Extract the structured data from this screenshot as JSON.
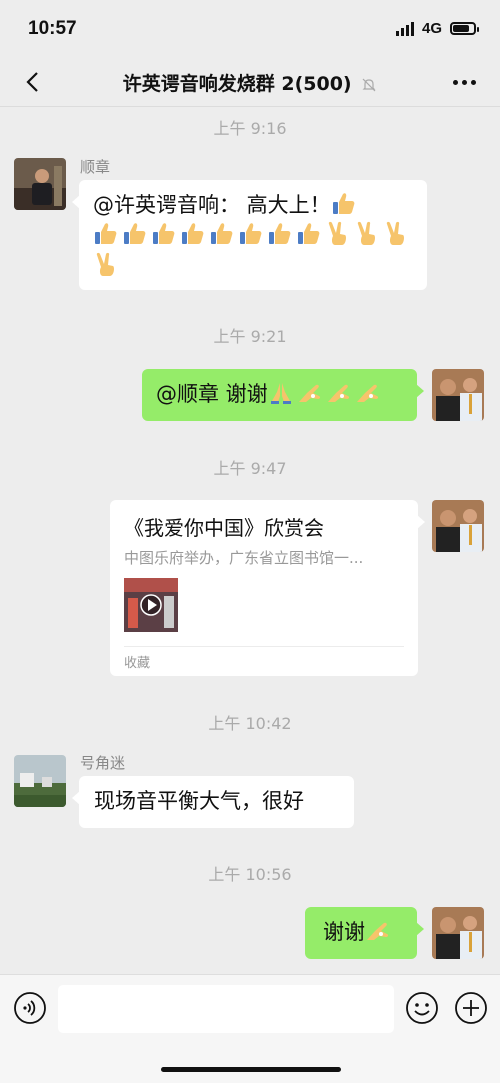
{
  "status_bar": {
    "time": "10:57",
    "network": "4G",
    "battery_level": 0.8
  },
  "nav": {
    "title": "许英谔音响发烧群 2(500)"
  },
  "messages": [
    {
      "time": "上午 9:16"
    },
    {
      "sender": "顺章",
      "text_prefix": "@许英谔音响： 高大上！"
    },
    {
      "time": "上午 9:21"
    },
    {
      "text": "@顺章 谢谢"
    },
    {
      "time": "上午 9:47"
    },
    {
      "card": {
        "title": "《我爱你中国》欣赏会",
        "description": "中图乐府举办，广东省立图书馆一...",
        "source": "收藏"
      }
    },
    {
      "time": "上午 10:42"
    },
    {
      "sender": "号角迷",
      "text": "现场音平衡大气，很好"
    },
    {
      "time": "上午 10:56"
    },
    {
      "text": "谢谢"
    }
  ],
  "emoji": {
    "thumbs_up": "thumbs-up-icon",
    "victory": "victory-hand-icon",
    "pray": "folded-hands-icon",
    "ok_hand": "ok-hand-icon"
  },
  "colors": {
    "outgoing_bubble": "#95ec69",
    "incoming_bubble": "#ffffff",
    "background": "#ededed"
  },
  "input": {
    "placeholder": ""
  }
}
